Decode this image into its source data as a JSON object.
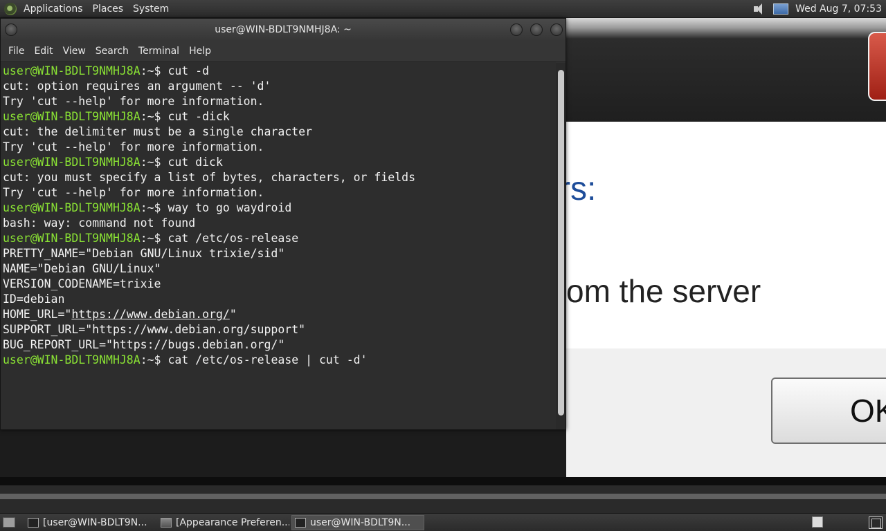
{
  "top_panel": {
    "menus": [
      "Applications",
      "Places",
      "System"
    ],
    "clock": "Wed Aug 7, 07:53"
  },
  "background_window": {
    "heading_fragment": "rs:",
    "message_fragment": "om the server",
    "button_label": "OK"
  },
  "terminal": {
    "title": "user@WIN-BDLT9NMHJ8A: ~",
    "menu": [
      "File",
      "Edit",
      "View",
      "Search",
      "Terminal",
      "Help"
    ],
    "prompt_user": "user@WIN-BDLT9NMHJ8A",
    "prompt_sym": ":~$ ",
    "lines": [
      {
        "type": "cmd",
        "text": "cut -d"
      },
      {
        "type": "out",
        "text": "cut: option requires an argument -- 'd'"
      },
      {
        "type": "out",
        "text": "Try 'cut --help' for more information."
      },
      {
        "type": "cmd",
        "text": "cut -dick"
      },
      {
        "type": "out",
        "text": "cut: the delimiter must be a single character"
      },
      {
        "type": "out",
        "text": "Try 'cut --help' for more information."
      },
      {
        "type": "cmd",
        "text": "cut dick"
      },
      {
        "type": "out",
        "text": "cut: you must specify a list of bytes, characters, or fields"
      },
      {
        "type": "out",
        "text": "Try 'cut --help' for more information."
      },
      {
        "type": "cmd",
        "text": "way to go waydroid"
      },
      {
        "type": "out",
        "text": "bash: way: command not found"
      },
      {
        "type": "cmd",
        "text": "cat /etc/os-release"
      },
      {
        "type": "out",
        "text": "PRETTY_NAME=\"Debian GNU/Linux trixie/sid\""
      },
      {
        "type": "out",
        "text": "NAME=\"Debian GNU/Linux\""
      },
      {
        "type": "out",
        "text": "VERSION_CODENAME=trixie"
      },
      {
        "type": "out",
        "text": "ID=debian"
      },
      {
        "type": "url",
        "prefix": "HOME_URL=\"",
        "url": "https://www.debian.org/",
        "suffix": "\""
      },
      {
        "type": "out",
        "text": "SUPPORT_URL=\"https://www.debian.org/support\""
      },
      {
        "type": "out",
        "text": "BUG_REPORT_URL=\"https://bugs.debian.org/\""
      },
      {
        "type": "cmd",
        "text": "cat /etc/os-release | cut -d'"
      }
    ]
  },
  "taskbar": {
    "tasks": [
      {
        "label": "[user@WIN-BDLT9N...",
        "active": false
      },
      {
        "label": "[Appearance Preferen...",
        "active": false
      },
      {
        "label": "user@WIN-BDLT9N...",
        "active": true
      }
    ]
  }
}
